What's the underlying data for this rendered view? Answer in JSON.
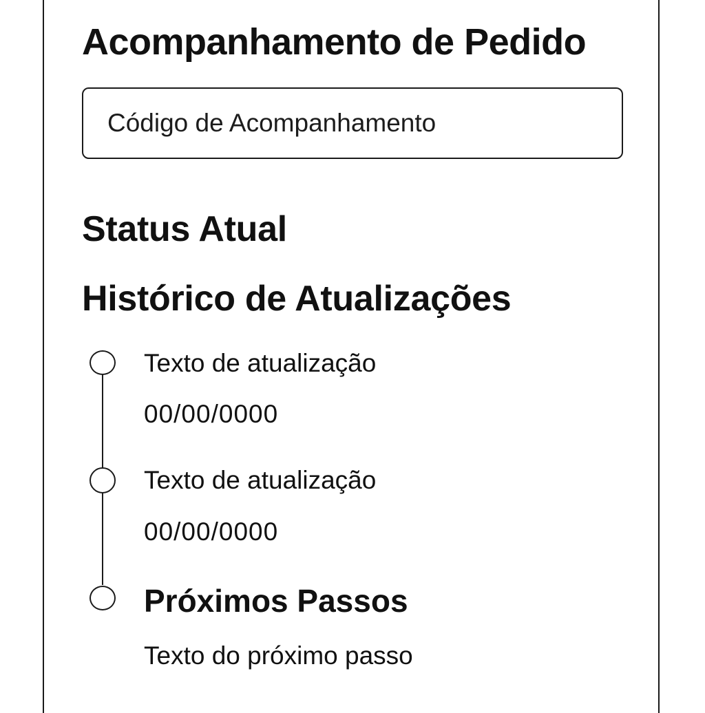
{
  "page": {
    "title": "Acompanhamento de Pedido"
  },
  "tracking": {
    "placeholder": "Código de Acompanhamento",
    "value": ""
  },
  "status": {
    "heading": "Status Atual"
  },
  "history": {
    "heading": "Histórico de Atualizações",
    "entries": [
      {
        "text": "Texto de atualização",
        "date": "00/00/0000"
      },
      {
        "text": "Texto de atualização",
        "date": "00/00/0000"
      }
    ]
  },
  "next_steps": {
    "heading": "Próximos Passos",
    "text": "Texto do próximo passo"
  },
  "colors": {
    "background": "#ffffff",
    "foreground": "#111111",
    "border": "#1a1a1a"
  }
}
